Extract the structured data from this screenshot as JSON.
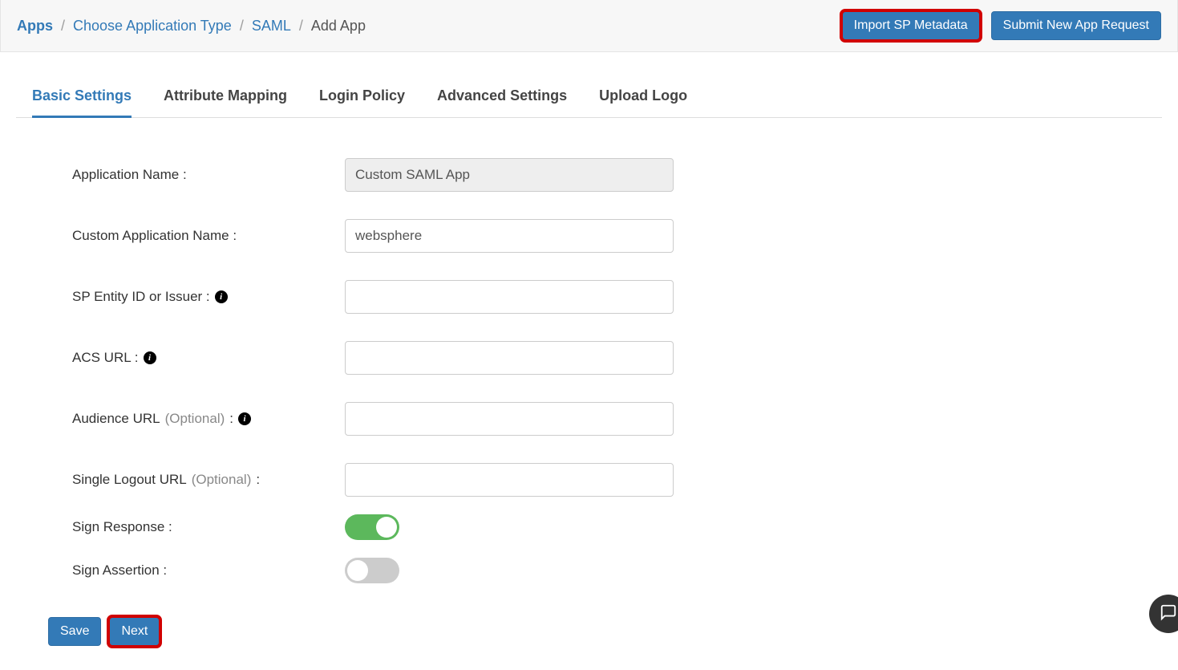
{
  "breadcrumb": {
    "apps": "Apps",
    "choose_type": "Choose Application Type",
    "saml": "SAML",
    "add_app": "Add App"
  },
  "top_actions": {
    "import": "Import SP Metadata",
    "submit": "Submit New App Request"
  },
  "tabs": {
    "basic": "Basic Settings",
    "attribute": "Attribute Mapping",
    "login": "Login Policy",
    "advanced": "Advanced Settings",
    "upload": "Upload Logo"
  },
  "form": {
    "app_name_label": "Application Name :",
    "app_name_value": "Custom SAML App",
    "custom_app_name_label": "Custom Application Name :",
    "custom_app_name_value": "websphere",
    "sp_entity_label": "SP Entity ID or Issuer :",
    "sp_entity_value": "",
    "acs_url_label": "ACS URL :",
    "acs_url_value": "",
    "audience_label_pre": "Audience URL ",
    "audience_label_opt": "(Optional)",
    "audience_label_post": " :",
    "audience_value": "",
    "slo_label_pre": "Single Logout URL ",
    "slo_label_opt": "(Optional)",
    "slo_label_post": " :",
    "slo_value": "",
    "sign_response_label": "Sign Response :",
    "sign_response_on": true,
    "sign_assertion_label": "Sign Assertion :",
    "sign_assertion_on": false
  },
  "footer": {
    "save": "Save",
    "next": "Next"
  }
}
